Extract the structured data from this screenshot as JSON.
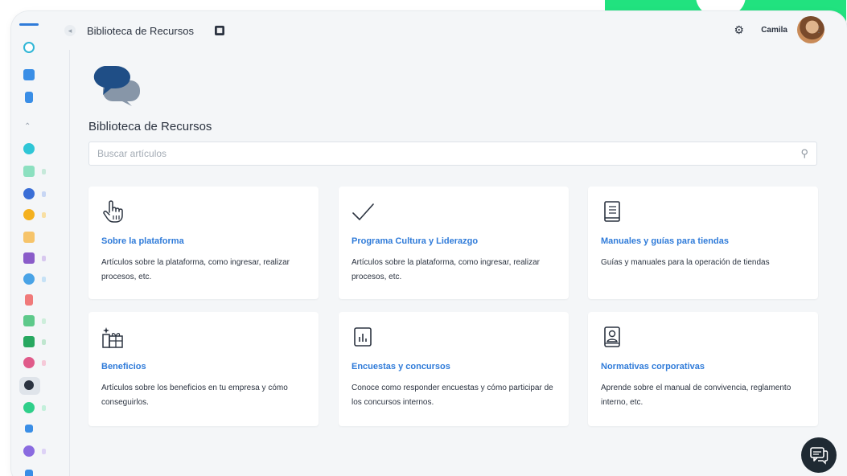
{
  "header": {
    "app_title": "Biblioteca de Recursos",
    "user_name": "Camila"
  },
  "page": {
    "heading": "Biblioteca de Recursos",
    "search_placeholder": "Buscar artículos"
  },
  "cards": [
    {
      "icon": "hand-pointer-icon",
      "title": "Sobre la plataforma",
      "description": "Artículos sobre la plataforma, como ingresar, realizar procesos, etc."
    },
    {
      "icon": "checkmark-icon",
      "title": "Programa Cultura y Liderazgo",
      "description": "Artículos sobre la plataforma, como ingresar, realizar procesos, etc."
    },
    {
      "icon": "book-icon",
      "title": "Manuales y guías para tiendas",
      "description": "Guías y manuales para la operación de tiendas"
    },
    {
      "icon": "gift-icon",
      "title": "Beneficios",
      "description": "Artículos sobre los beneficios en tu empresa y cómo conseguirlos."
    },
    {
      "icon": "bar-chart-icon",
      "title": "Encuestas y concursos",
      "description": "Conoce como responder encuestas y cómo participar de los concursos internos."
    },
    {
      "icon": "id-badge-icon",
      "title": "Normativas corporativas",
      "description": "Aprende sobre el manual de convivencia, reglamento interno, etc."
    }
  ],
  "colors": {
    "accent": "#2f7bd9",
    "brand_green": "#21e27f",
    "background": "#f4f6f8",
    "hero_icon_dark": "#1f4e86",
    "hero_icon_light": "#8796a8"
  }
}
